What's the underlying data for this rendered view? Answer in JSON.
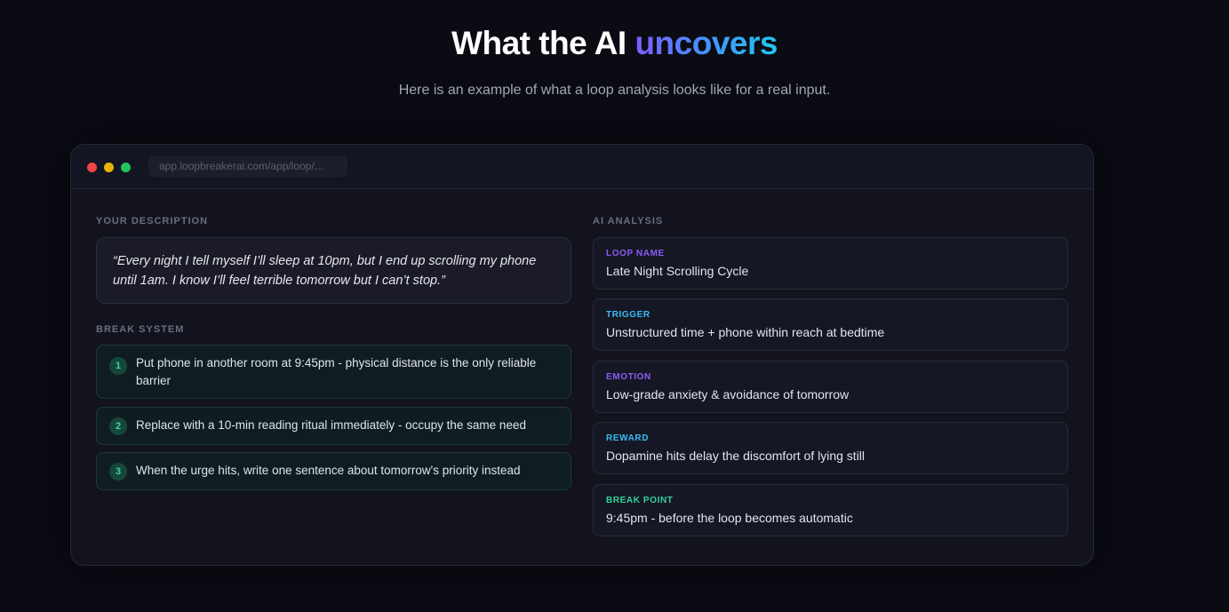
{
  "header": {
    "title_prefix": "What the AI ",
    "title_accent": "uncovers",
    "subtitle": "Here is an example of what a loop analysis looks like for a real input."
  },
  "browser": {
    "url": "app.loopbreakerai.com/app/loop/..."
  },
  "description": {
    "label": "YOUR DESCRIPTION",
    "quote": "“Every night I tell myself I’ll sleep at 10pm, but I end up scrolling my phone until 1am. I know I’ll feel terrible tomorrow but I can’t stop.”"
  },
  "break_system": {
    "label": "BREAK SYSTEM",
    "steps": [
      {
        "num": "1",
        "text": "Put phone in another room at 9:45pm - physical distance is the only reliable barrier"
      },
      {
        "num": "2",
        "text": "Replace with a 10-min reading ritual immediately - occupy the same need"
      },
      {
        "num": "3",
        "text": "When the urge hits, write one sentence about tomorrow's priority instead"
      }
    ]
  },
  "analysis": {
    "label": "AI ANALYSIS",
    "cards": [
      {
        "label": "LOOP NAME",
        "value": "Late Night Scrolling Cycle",
        "color": "#8b5cf6"
      },
      {
        "label": "TRIGGER",
        "value": "Unstructured time + phone within reach at bedtime",
        "color": "#38bdf8"
      },
      {
        "label": "EMOTION",
        "value": "Low-grade anxiety & avoidance of tomorrow",
        "color": "#8b5cf6"
      },
      {
        "label": "REWARD",
        "value": "Dopamine hits delay the discomfort of lying still",
        "color": "#38bdf8"
      },
      {
        "label": "BREAK POINT",
        "value": "9:45pm - before the loop becomes automatic",
        "color": "#34d399"
      }
    ]
  }
}
